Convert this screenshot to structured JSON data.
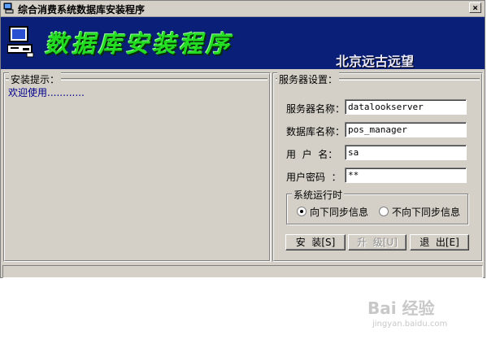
{
  "window": {
    "title": "综合消费系统数据库安装程序",
    "close_label": "×"
  },
  "banner": {
    "title": "数据库安装程序",
    "company": "北京远古远望"
  },
  "hint_panel": {
    "legend": "安装提示：",
    "message": "欢迎使用............"
  },
  "server_panel": {
    "legend": "服务器设置：",
    "fields": [
      {
        "label": "服务器名称：",
        "value": "datalookserver"
      },
      {
        "label": "数据库名称：",
        "value": "pos_manager"
      },
      {
        "label": "用  户  名：",
        "value": "sa"
      },
      {
        "label": "用户密码  ：",
        "value": "**"
      }
    ],
    "run_group": {
      "legend": "系统运行时",
      "options": [
        {
          "label": "向下同步信息",
          "selected": true
        },
        {
          "label": "不向下同步信息",
          "selected": false
        }
      ]
    },
    "buttons": {
      "install": "安  装[S]",
      "upgrade": "升  级[U]",
      "exit": "退  出[E]"
    }
  },
  "watermark": {
    "text": "Bai 经验",
    "sub": "jingyan.baidu.com"
  },
  "colors": {
    "banner_bg": "#0a1f78",
    "banner_title": "#22dd22",
    "hint_text": "#00008b",
    "face": "#d4d0c8"
  },
  "icons": {
    "title": "computer-icon",
    "banner": "computer-icon",
    "close": "close-icon"
  }
}
